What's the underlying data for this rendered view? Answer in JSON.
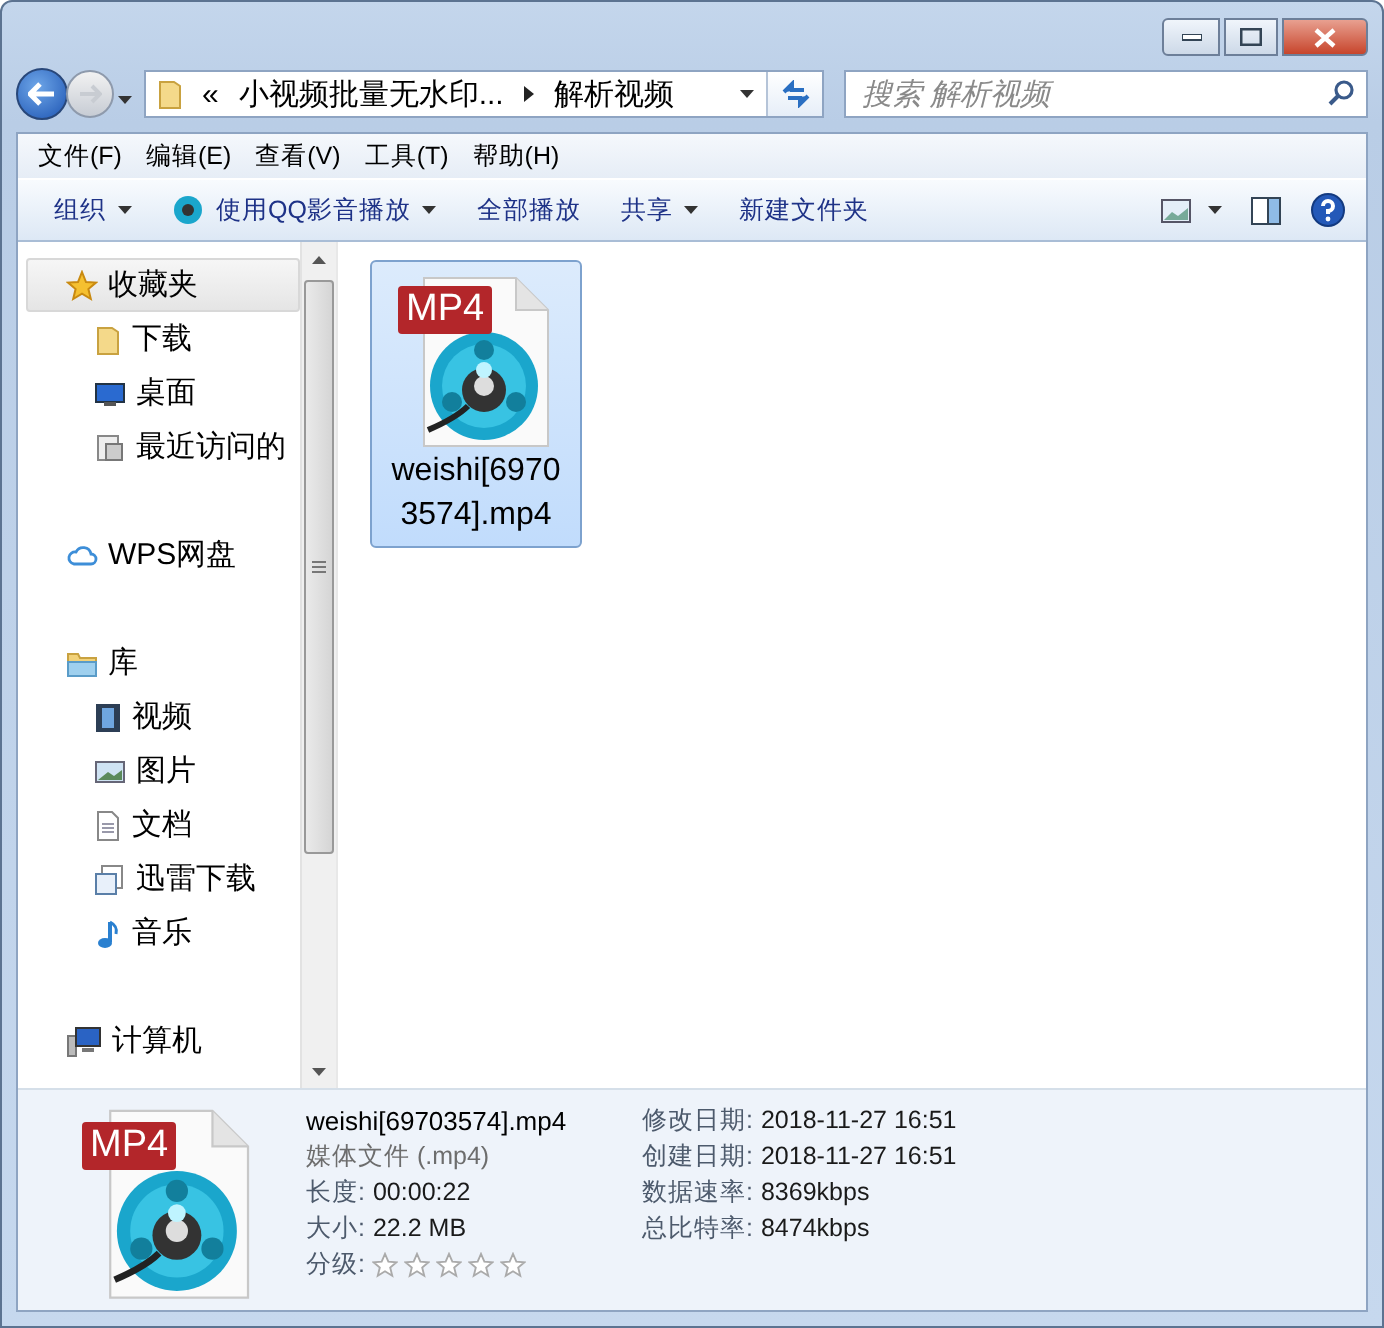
{
  "address": {
    "prefix": "«",
    "crumbs": [
      "小视频批量无水印...",
      "解析视频"
    ]
  },
  "search": {
    "placeholder": "搜索 解析视频"
  },
  "menu": [
    "文件(F)",
    "编辑(E)",
    "查看(V)",
    "工具(T)",
    "帮助(H)"
  ],
  "toolbar": [
    {
      "label": "组织",
      "dropdown": true
    },
    {
      "label": "使用QQ影音播放",
      "dropdown": true
    },
    {
      "label": "全部播放",
      "dropdown": false
    },
    {
      "label": "共享",
      "dropdown": true
    },
    {
      "label": "新建文件夹",
      "dropdown": false
    }
  ],
  "sidebar": {
    "groups": [
      {
        "label": "收藏夹",
        "selected": true,
        "children": [
          {
            "label": "下载"
          },
          {
            "label": "桌面"
          },
          {
            "label": "最近访问的"
          }
        ]
      },
      {
        "label": "WPS网盘",
        "selected": false
      },
      {
        "label": "库",
        "selected": false,
        "children": [
          {
            "label": "视频"
          },
          {
            "label": "图片"
          },
          {
            "label": "文档"
          },
          {
            "label": "迅雷下载"
          },
          {
            "label": "音乐"
          }
        ]
      },
      {
        "label": "计算机",
        "selected": false
      }
    ]
  },
  "files": [
    {
      "name": "weishi[69703574].mp4",
      "badge": "MP4",
      "selected": true
    }
  ],
  "details": {
    "badge": "MP4",
    "name": "weishi[69703574].mp4",
    "type": "媒体文件 (.mp4)",
    "left": [
      {
        "label": "长度:",
        "value": "00:00:22"
      },
      {
        "label": "大小:",
        "value": "22.2 MB"
      }
    ],
    "rating": {
      "label": "分级:",
      "stars": 0
    },
    "right": [
      {
        "label": "修改日期:",
        "value": "2018-11-27 16:51"
      },
      {
        "label": "创建日期:",
        "value": "2018-11-27 16:51"
      },
      {
        "label": "数据速率:",
        "value": "8369kbps"
      },
      {
        "label": "总比特率:",
        "value": "8474kbps"
      }
    ]
  }
}
